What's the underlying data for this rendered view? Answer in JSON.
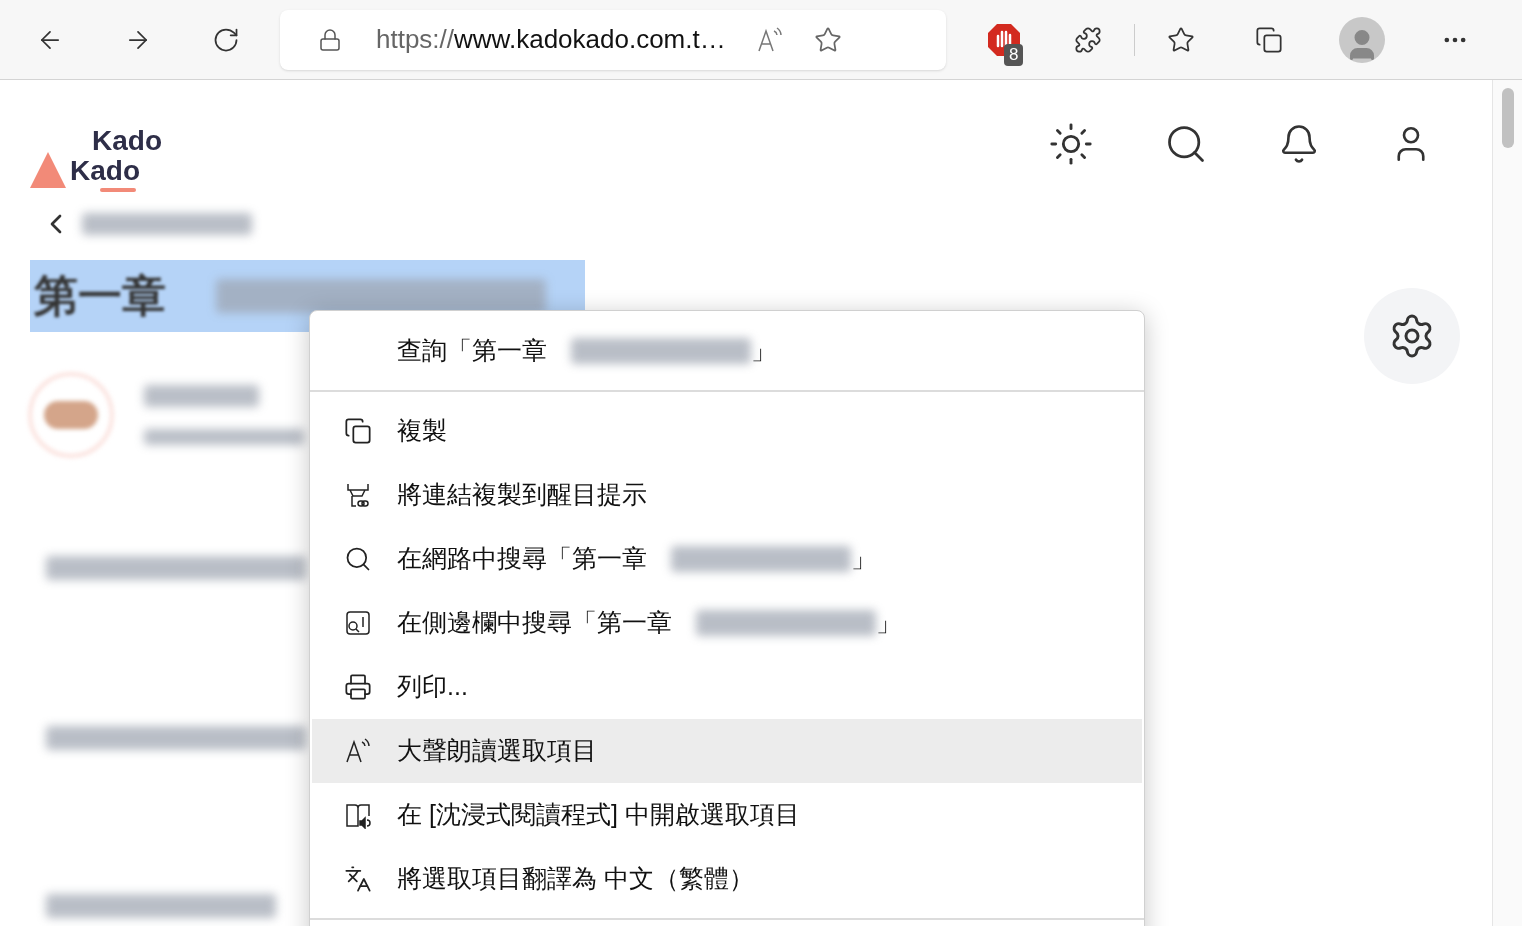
{
  "browser": {
    "url_scheme": "https://",
    "url_rest": "www.kadokado.com.t…",
    "blocker_badge": "8"
  },
  "site": {
    "logo_words": [
      "Kado",
      "Kado"
    ],
    "title_visible": "第一章"
  },
  "context_menu": {
    "items": [
      {
        "kind": "lookup",
        "text": "查詢「第一章",
        "after": "」",
        "selected": false
      },
      {
        "kind": "divider"
      },
      {
        "kind": "copy",
        "text": "複製",
        "selected": false
      },
      {
        "kind": "link",
        "text": "將連結複製到醒目提示",
        "selected": false
      },
      {
        "kind": "web-search",
        "text": "在網路中搜尋「第一章",
        "after": "」",
        "selected": false
      },
      {
        "kind": "sidebar-search",
        "text": "在側邊欄中搜尋「第一章",
        "after": "」",
        "selected": false
      },
      {
        "kind": "print",
        "text": "列印...",
        "selected": false
      },
      {
        "kind": "read-aloud",
        "text": "大聲朗讀選取項目",
        "selected": true
      },
      {
        "kind": "reader",
        "text": "在 [沈浸式閱讀程式] 中開啟選取項目",
        "selected": false
      },
      {
        "kind": "translate",
        "text": "將選取項目翻譯為 中文（繁體）",
        "selected": false
      },
      {
        "kind": "divider"
      }
    ]
  }
}
